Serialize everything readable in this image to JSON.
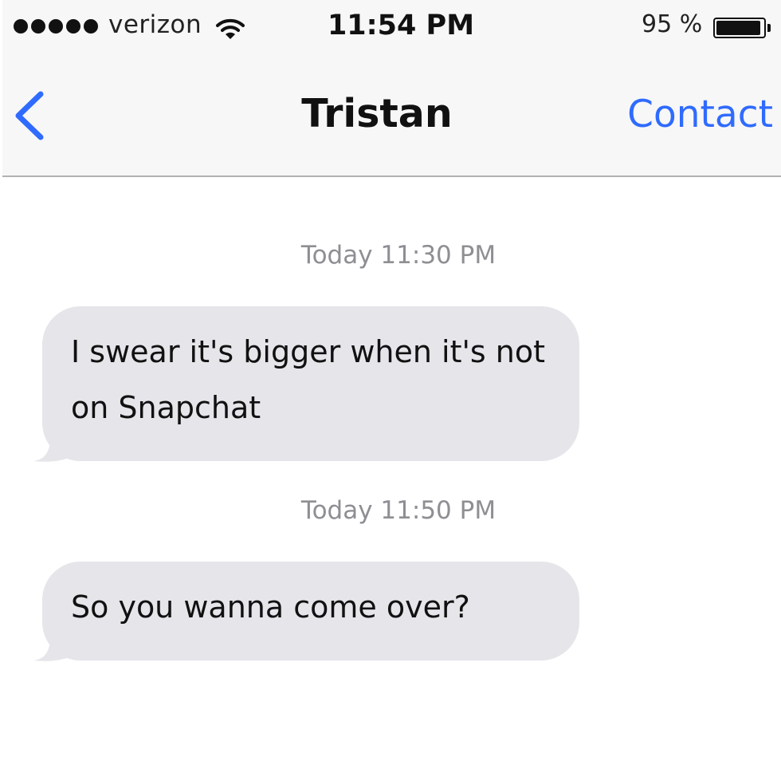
{
  "status_bar": {
    "carrier": "verizon",
    "time": "11:54 PM",
    "battery_percent": "95 %",
    "battery_level": 0.95,
    "signal_bars": 5
  },
  "nav": {
    "back_icon": "chevron-left-icon",
    "title": "Tristan",
    "contact_label": "Contact"
  },
  "conversation": {
    "messages": [
      {
        "timestamp": "Today 11:30 PM",
        "text": "I swear it's bigger when it's not on Snapchat"
      },
      {
        "timestamp": "Today 11:50 PM",
        "text": "So you wanna come over?"
      }
    ]
  },
  "colors": {
    "accent": "#2f6bff",
    "bubble_incoming": "#e5e5ea",
    "timestamp_text": "#8e8e93",
    "nav_background": "#f7f7f7"
  }
}
